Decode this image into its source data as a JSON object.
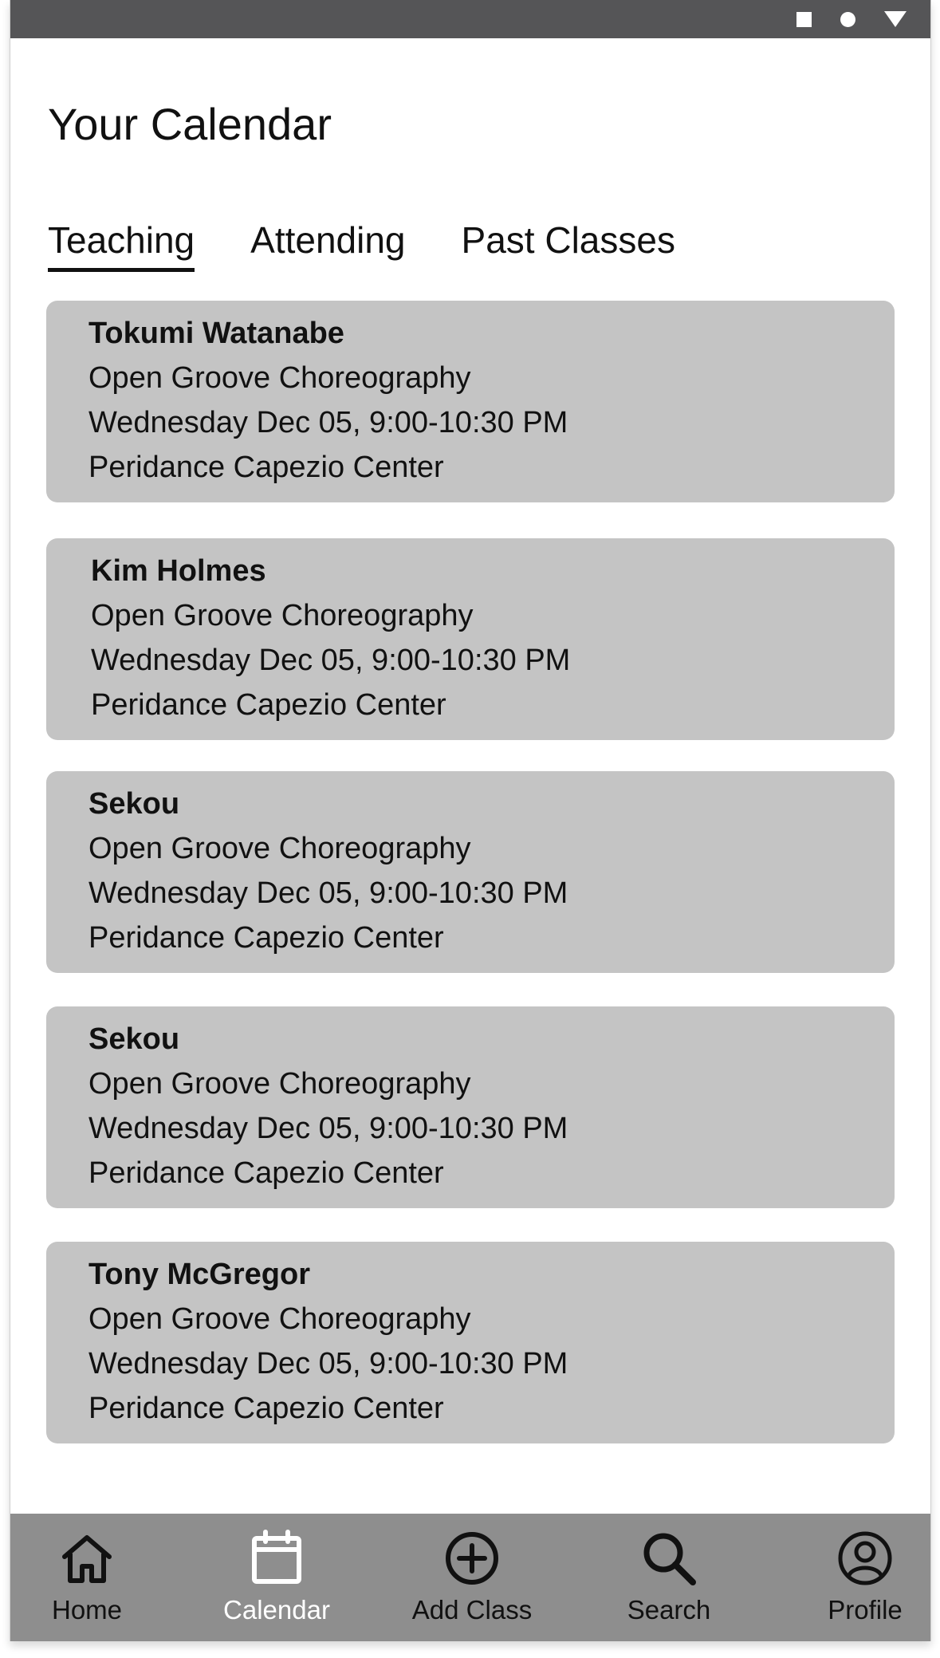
{
  "status_bar": {
    "icons": [
      "square-icon",
      "circle-icon",
      "triangle-icon"
    ]
  },
  "page": {
    "title": "Your Calendar"
  },
  "tabs": [
    {
      "label": "Teaching",
      "active": true
    },
    {
      "label": "Attending",
      "active": false
    },
    {
      "label": "Past Classes",
      "active": false
    }
  ],
  "classes": [
    {
      "instructor": "Tokumi Watanabe",
      "class_name": "Open Groove Choreography",
      "datetime": "Wednesday Dec 05, 9:00-10:30 PM",
      "location": "Peridance Capezio Center"
    },
    {
      "instructor": "Kim Holmes",
      "class_name": "Open Groove Choreography",
      "datetime": "Wednesday Dec 05, 9:00-10:30 PM",
      "location": "Peridance Capezio Center"
    },
    {
      "instructor": "Sekou",
      "class_name": "Open Groove Choreography",
      "datetime": "Wednesday Dec 05, 9:00-10:30 PM",
      "location": "Peridance Capezio Center"
    },
    {
      "instructor": "Sekou",
      "class_name": "Open Groove Choreography",
      "datetime": "Wednesday Dec 05, 9:00-10:30 PM",
      "location": "Peridance Capezio Center"
    },
    {
      "instructor": "Tony McGregor",
      "class_name": "Open Groove Choreography",
      "datetime": "Wednesday Dec 05, 9:00-10:30 PM",
      "location": "Peridance Capezio Center"
    }
  ],
  "bottom_nav": [
    {
      "label": "Home",
      "icon": "home-icon",
      "active": false
    },
    {
      "label": "Calendar",
      "icon": "calendar-icon",
      "active": true
    },
    {
      "label": "Add Class",
      "icon": "add-circle-icon",
      "active": false
    },
    {
      "label": "Search",
      "icon": "search-icon",
      "active": false
    },
    {
      "label": "Profile",
      "icon": "profile-icon",
      "active": false
    }
  ],
  "colors": {
    "status_bar": "#555557",
    "card_bg": "#c4c4c4",
    "nav_bg": "#8e8e8e",
    "nav_active_label": "#ffffff"
  }
}
